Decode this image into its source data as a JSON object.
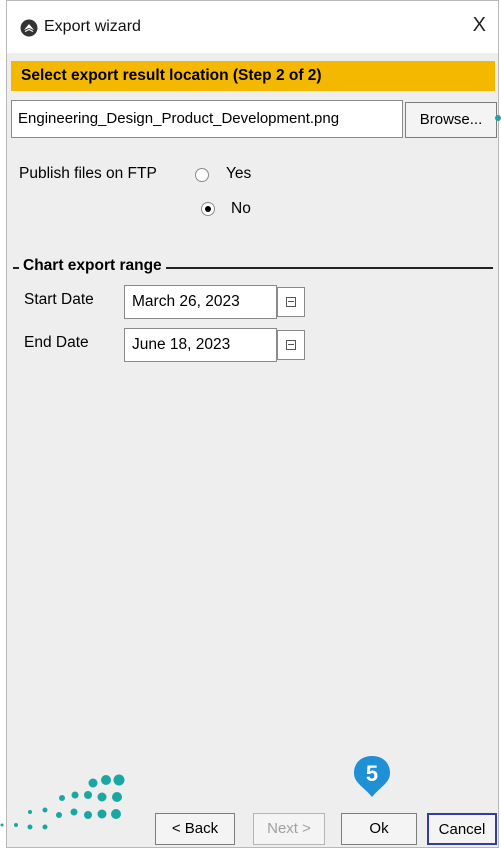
{
  "window": {
    "title": "Export wizard",
    "close_label": "X",
    "app_icon": "export-wizard-icon"
  },
  "banner": {
    "text": "Select export result location (Step 2 of 2)",
    "color": "#f5b800"
  },
  "output": {
    "path_value": "Engineering_Design_Product_Development.png",
    "browse_label": "Browse..."
  },
  "publish": {
    "label": "Publish files on FTP",
    "options": [
      {
        "label": "Yes",
        "checked": false
      },
      {
        "label": "No",
        "checked": true
      }
    ]
  },
  "range": {
    "title": "Chart export range",
    "start_label": "Start Date",
    "start_value": "March 26, 2023",
    "end_label": "End Date",
    "end_value": "June 18, 2023"
  },
  "buttons": {
    "back": "< Back",
    "next": "Next >",
    "ok": "Ok",
    "cancel": "Cancel"
  },
  "step_marker": {
    "number": "5",
    "color": "#1f8fd6"
  },
  "logo": {
    "color": "#1aa7a3"
  }
}
